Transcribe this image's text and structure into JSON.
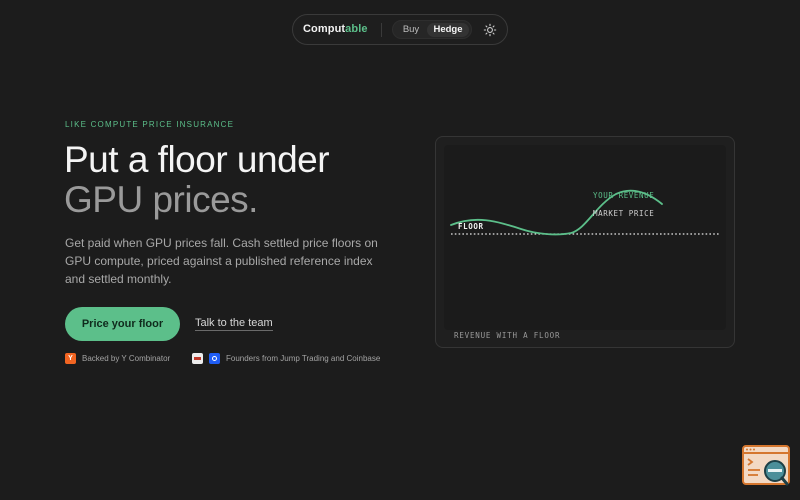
{
  "nav": {
    "brand_part1": "Comput",
    "brand_part2": "able",
    "toggle": {
      "buy": "Buy",
      "hedge": "Hedge",
      "selected": "Hedge"
    },
    "theme_icon": "sun-icon"
  },
  "hero": {
    "eyebrow": "LIKE COMPUTE PRICE INSURANCE",
    "headline_line1": "Put a floor under",
    "headline_line2": "GPU prices.",
    "subtext": "Get paid when GPU prices fall. Cash settled price floors on GPU compute, priced against a published reference index and settled monthly.",
    "cta_primary": "Price your floor",
    "cta_secondary": "Talk to the team",
    "trust": {
      "yc_badge": "Y",
      "yc_text": "Backed by Y Combinator",
      "founders_text": "Founders from Jump Trading and Coinbase"
    }
  },
  "chart_card": {
    "labels": {
      "your_revenue": "YOUR REVENUE",
      "market_price": "MARKET PRICE",
      "floor": "FLOOR"
    },
    "caption": "REVENUE WITH A FLOOR"
  },
  "colors": {
    "accent": "#5cbf8a",
    "background": "#1c1c1c",
    "headline_muted": "#9a9a9a"
  },
  "corner_widget_icon": "terminal-search-icon"
}
